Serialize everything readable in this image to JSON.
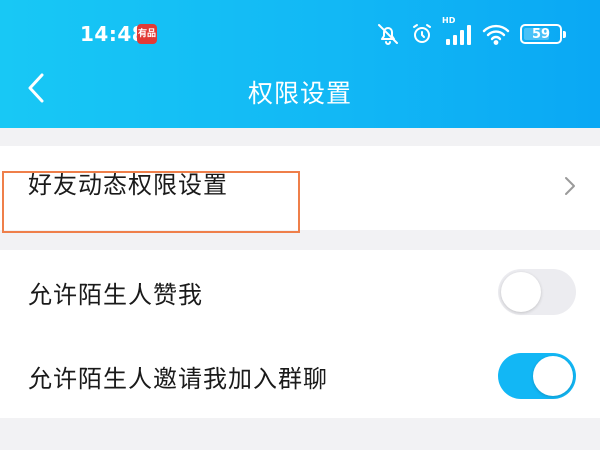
{
  "status_bar": {
    "time": "14:48",
    "app_badge": "有品",
    "network_label": "HD",
    "battery_percent": "59"
  },
  "nav": {
    "title": "权限设置"
  },
  "sections": [
    {
      "rows": [
        {
          "label": "好友动态权限设置",
          "type": "link"
        }
      ]
    },
    {
      "rows": [
        {
          "label": "允许陌生人赞我",
          "type": "toggle",
          "enabled": false
        },
        {
          "label": "允许陌生人邀请我加入群聊",
          "type": "toggle",
          "enabled": true
        }
      ]
    }
  ],
  "colors": {
    "header_gradient_start": "#18c8f5",
    "header_gradient_end": "#0aa8f4",
    "toggle_on": "#12b7f5",
    "toggle_off": "#ececf0",
    "highlight_border": "#ef7f4a",
    "page_background": "#f2f2f4"
  },
  "icons": [
    "back-arrow-icon",
    "chevron-right-icon",
    "mute-icon",
    "alarm-icon",
    "signal-icon",
    "wifi-icon",
    "battery-icon"
  ]
}
